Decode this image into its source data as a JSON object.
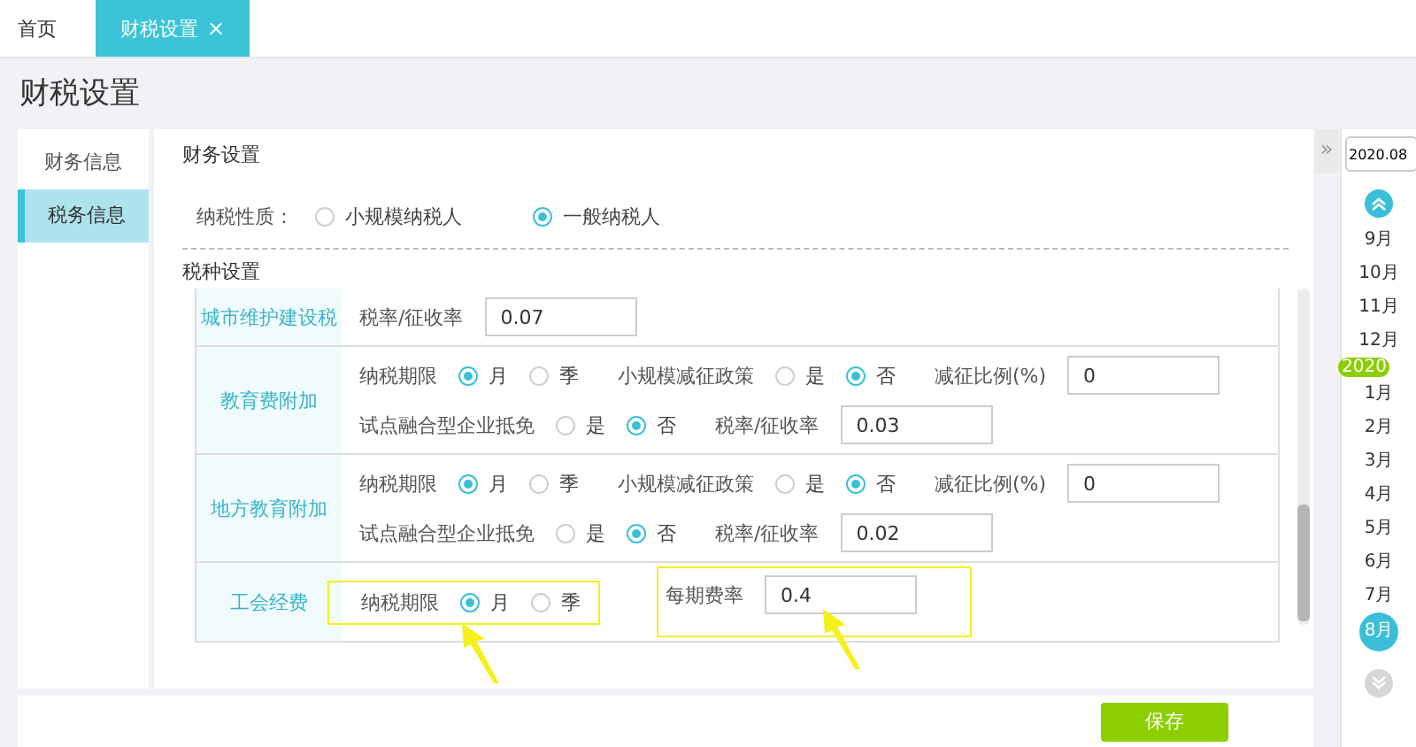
{
  "tabs": [
    {
      "label": "首页",
      "selected": false
    },
    {
      "label": "财税设置",
      "selected": true,
      "close": "×"
    }
  ],
  "page_title": "财税设置",
  "sidebar": {
    "items": [
      {
        "label": "财务信息",
        "selected": false
      },
      {
        "label": "税务信息",
        "selected": true
      }
    ]
  },
  "finance_section": {
    "title": "财务设置",
    "field_label": "纳税性质：",
    "options": [
      {
        "label": "小规模纳税人",
        "selected": false
      },
      {
        "label": "一般纳税人",
        "selected": true
      }
    ]
  },
  "tax_section": {
    "title": "税种设置",
    "rows": [
      {
        "name": "城市维护建设税",
        "lines": [
          [
            {
              "kind": "input",
              "label": "税率/征收率",
              "value": "0.07",
              "highlighted": false
            }
          ]
        ]
      },
      {
        "name": "教育费附加",
        "lines": [
          [
            {
              "kind": "radio",
              "label": "纳税期限",
              "options": [
                {
                  "label": "月",
                  "selected": true
                },
                {
                  "label": "季",
                  "selected": false
                }
              ],
              "highlighted": false
            },
            {
              "kind": "radio",
              "label": "小规模减征政策",
              "options": [
                {
                  "label": "是",
                  "selected": false
                },
                {
                  "label": "否",
                  "selected": true
                }
              ],
              "highlighted": false
            },
            {
              "kind": "input",
              "label": "减征比例(%)",
              "value": "0",
              "highlighted": false
            }
          ],
          [
            {
              "kind": "radio",
              "label": "试点融合型企业抵免",
              "options": [
                {
                  "label": "是",
                  "selected": false
                },
                {
                  "label": "否",
                  "selected": true
                }
              ],
              "highlighted": false
            },
            {
              "kind": "input",
              "label": "税率/征收率",
              "value": "0.03",
              "highlighted": false
            }
          ]
        ]
      },
      {
        "name": "地方教育附加",
        "lines": [
          [
            {
              "kind": "radio",
              "label": "纳税期限",
              "options": [
                {
                  "label": "月",
                  "selected": true
                },
                {
                  "label": "季",
                  "selected": false
                }
              ],
              "highlighted": false
            },
            {
              "kind": "radio",
              "label": "小规模减征政策",
              "options": [
                {
                  "label": "是",
                  "selected": false
                },
                {
                  "label": "否",
                  "selected": true
                }
              ],
              "highlighted": false
            },
            {
              "kind": "input",
              "label": "减征比例(%)",
              "value": "0",
              "highlighted": false
            }
          ],
          [
            {
              "kind": "radio",
              "label": "试点融合型企业抵免",
              "options": [
                {
                  "label": "是",
                  "selected": false
                },
                {
                  "label": "否",
                  "selected": true
                }
              ],
              "highlighted": false
            },
            {
              "kind": "input",
              "label": "税率/征收率",
              "value": "0.02",
              "highlighted": false
            }
          ]
        ]
      },
      {
        "name": "工会经费",
        "lines": [
          [
            {
              "kind": "radio",
              "label": "纳税期限",
              "options": [
                {
                  "label": "月",
                  "selected": true
                },
                {
                  "label": "季",
                  "selected": false
                }
              ],
              "highlighted": true
            },
            {
              "kind": "input",
              "label": "每期费率",
              "value": "0.4",
              "highlighted": true
            }
          ]
        ]
      }
    ]
  },
  "save_button": "保存",
  "timeline": {
    "collapse": "»",
    "date_value": "2020.08",
    "year_badge": "2020",
    "months": [
      {
        "label": "9月",
        "selected": false
      },
      {
        "label": "10月",
        "selected": false
      },
      {
        "label": "11月",
        "selected": false
      },
      {
        "label": "12月",
        "selected": false
      },
      {
        "label": "1月",
        "selected": false
      },
      {
        "label": "2月",
        "selected": false
      },
      {
        "label": "3月",
        "selected": false
      },
      {
        "label": "4月",
        "selected": false
      },
      {
        "label": "5月",
        "selected": false
      },
      {
        "label": "6月",
        "selected": false
      },
      {
        "label": "7月",
        "selected": false
      },
      {
        "label": "8月",
        "selected": true
      }
    ]
  }
}
